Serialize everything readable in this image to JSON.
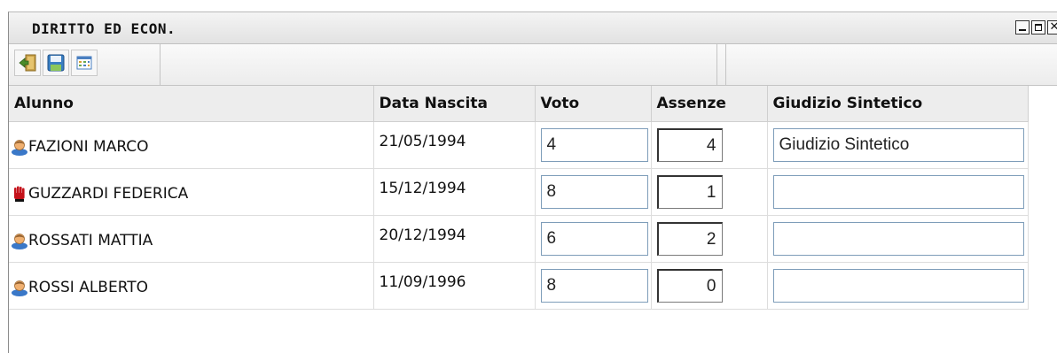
{
  "window": {
    "title": "DIRITTO ED ECON.",
    "controls": [
      "minimize-icon",
      "maximize-icon",
      "close-icon"
    ]
  },
  "toolbar": {
    "buttons": [
      {
        "name": "exit-icon",
        "color": "#4a8c2a"
      },
      {
        "name": "save-icon",
        "color": "#3a7fc2"
      },
      {
        "name": "grid-view-icon",
        "color": "#4a7fc0"
      }
    ]
  },
  "table": {
    "headers": {
      "alunno": "Alunno",
      "data_nascita": "Data Nascita",
      "voto": "Voto",
      "assenze": "Assenze",
      "giudizio": "Giudizio Sintetico"
    },
    "rows": [
      {
        "icon": "student-icon",
        "name": "FAZIONI MARCO",
        "birth": "21/05/1994",
        "voto": "4",
        "assenze": "4",
        "giudizio": "Giudizio Sintetico"
      },
      {
        "icon": "stop-hand-icon",
        "name": "GUZZARDI FEDERICA",
        "birth": "15/12/1994",
        "voto": "8",
        "assenze": "1",
        "giudizio": ""
      },
      {
        "icon": "student-icon",
        "name": "ROSSATI MATTIA",
        "birth": "20/12/1994",
        "voto": "6",
        "assenze": "2",
        "giudizio": ""
      },
      {
        "icon": "student-icon",
        "name": "ROSSI ALBERTO",
        "birth": "11/09/1996",
        "voto": "8",
        "assenze": "0",
        "giudizio": ""
      }
    ]
  }
}
